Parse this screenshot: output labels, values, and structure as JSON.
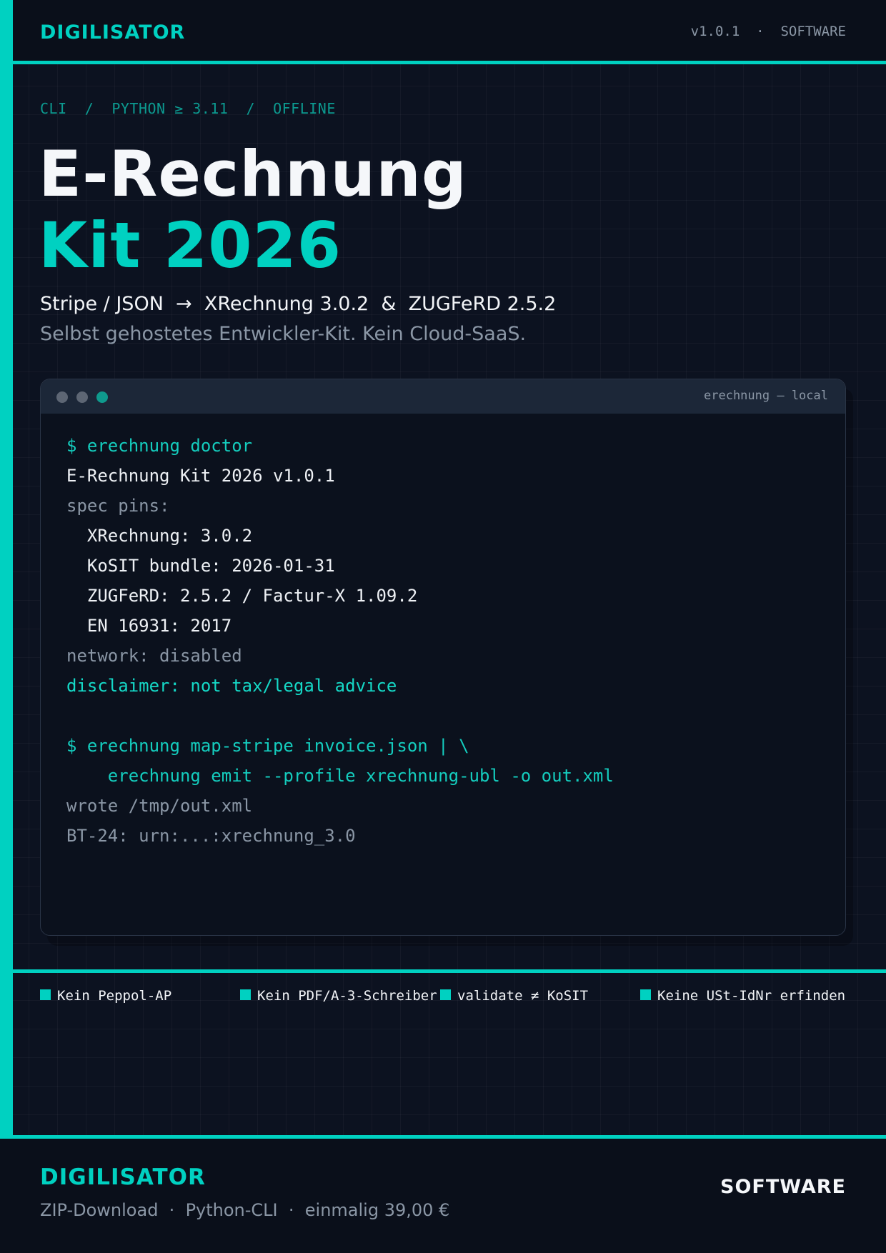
{
  "header": {
    "brand": "DIGILISATOR",
    "version": "v1.0.1  ·  SOFTWARE"
  },
  "hero": {
    "kicker": "CLI  /  PYTHON ≥ 3.11  /  OFFLINE",
    "title_line1": "E-Rechnung",
    "title_line2": "Kit 2026",
    "subtitle": "Stripe / JSON  →  XRechnung 3.0.2  &  ZUGFeRD 2.5.2",
    "tagline": "Selbst gehostetes Entwickler-Kit. Kein Cloud-SaaS."
  },
  "terminal": {
    "title": "erechnung — local",
    "lines": [
      "$ erechnung doctor",
      "E-Rechnung Kit 2026 v1.0.1",
      "spec pins:",
      "  XRechnung: 3.0.2",
      "  KoSIT bundle: 2026-01-31",
      "  ZUGFeRD: 2.5.2 / Factur-X 1.09.2",
      "  EN 16931: 2017",
      "network: disabled",
      "disclaimer: not tax/legal advice",
      "",
      "$ erechnung map-stripe invoice.json | \\",
      "    erechnung emit --profile xrechnung-ubl -o out.xml",
      "wrote /tmp/out.xml",
      "BT-24: urn:...:xrechnung_3.0"
    ]
  },
  "features": [
    "Kein Peppol-AP",
    "Kein PDF/A-3-Schreiber",
    "validate ≠ KoSIT",
    "Keine USt-IdNr erfinden"
  ],
  "footer": {
    "brand": "DIGILISATOR",
    "details": "ZIP-Download  ·  Python-CLI  ·  einmalig 39,00 €",
    "category": "SOFTWARE"
  },
  "colors": {
    "accent": "#00d1c1",
    "background": "#0c1220",
    "panel": "#0b111d"
  }
}
